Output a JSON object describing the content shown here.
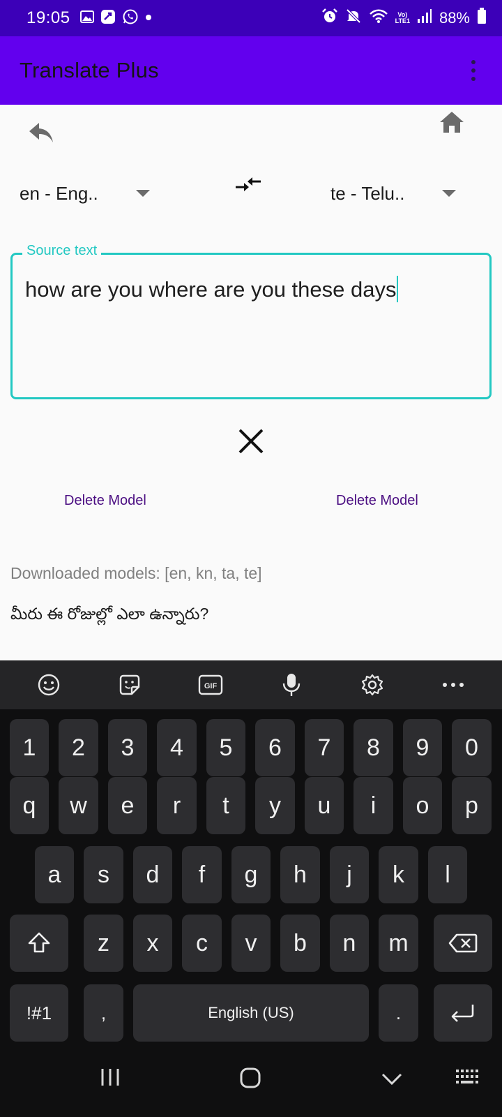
{
  "status_bar": {
    "time": "19:05",
    "battery": "88%",
    "network_top": "Vo)",
    "network_bottom": "LTE1"
  },
  "app_bar": {
    "title": "Translate Plus"
  },
  "source_lang": "en - Eng..",
  "target_lang": "te - Telu..",
  "source_field": {
    "label": "Source text",
    "value": "how are you where are you these days"
  },
  "delete_model_left": "Delete Model",
  "delete_model_right": "Delete Model",
  "downloaded_models": "Downloaded models: [en, kn, ta, te]",
  "translation_output": "మీరు ఈ రోజుల్లో ఎలా ఉన్నారు?",
  "keyboard": {
    "row1": [
      "1",
      "2",
      "3",
      "4",
      "5",
      "6",
      "7",
      "8",
      "9",
      "0"
    ],
    "row2": [
      "q",
      "w",
      "e",
      "r",
      "t",
      "y",
      "u",
      "i",
      "o",
      "p"
    ],
    "row3": [
      "a",
      "s",
      "d",
      "f",
      "g",
      "h",
      "j",
      "k",
      "l"
    ],
    "row4": [
      "z",
      "x",
      "c",
      "v",
      "b",
      "n",
      "m"
    ],
    "symbols_key": "!#1",
    "comma_key": ",",
    "space_key": "English (US)",
    "period_key": ".",
    "gif_label": "GIF"
  },
  "icons": {
    "toolbar": [
      "emoji-icon",
      "sticker-icon",
      "gif-icon",
      "microphone-icon",
      "settings-icon",
      "more-icon"
    ],
    "navbar": [
      "recent-apps-icon",
      "home-nav-icon",
      "back-nav-icon",
      "keyboard-switch-icon"
    ]
  },
  "colors": {
    "status_bar": "#3c00b8",
    "app_bar": "#6200ee",
    "accent": "#22c8c2",
    "delete_text": "#4b0e82"
  }
}
